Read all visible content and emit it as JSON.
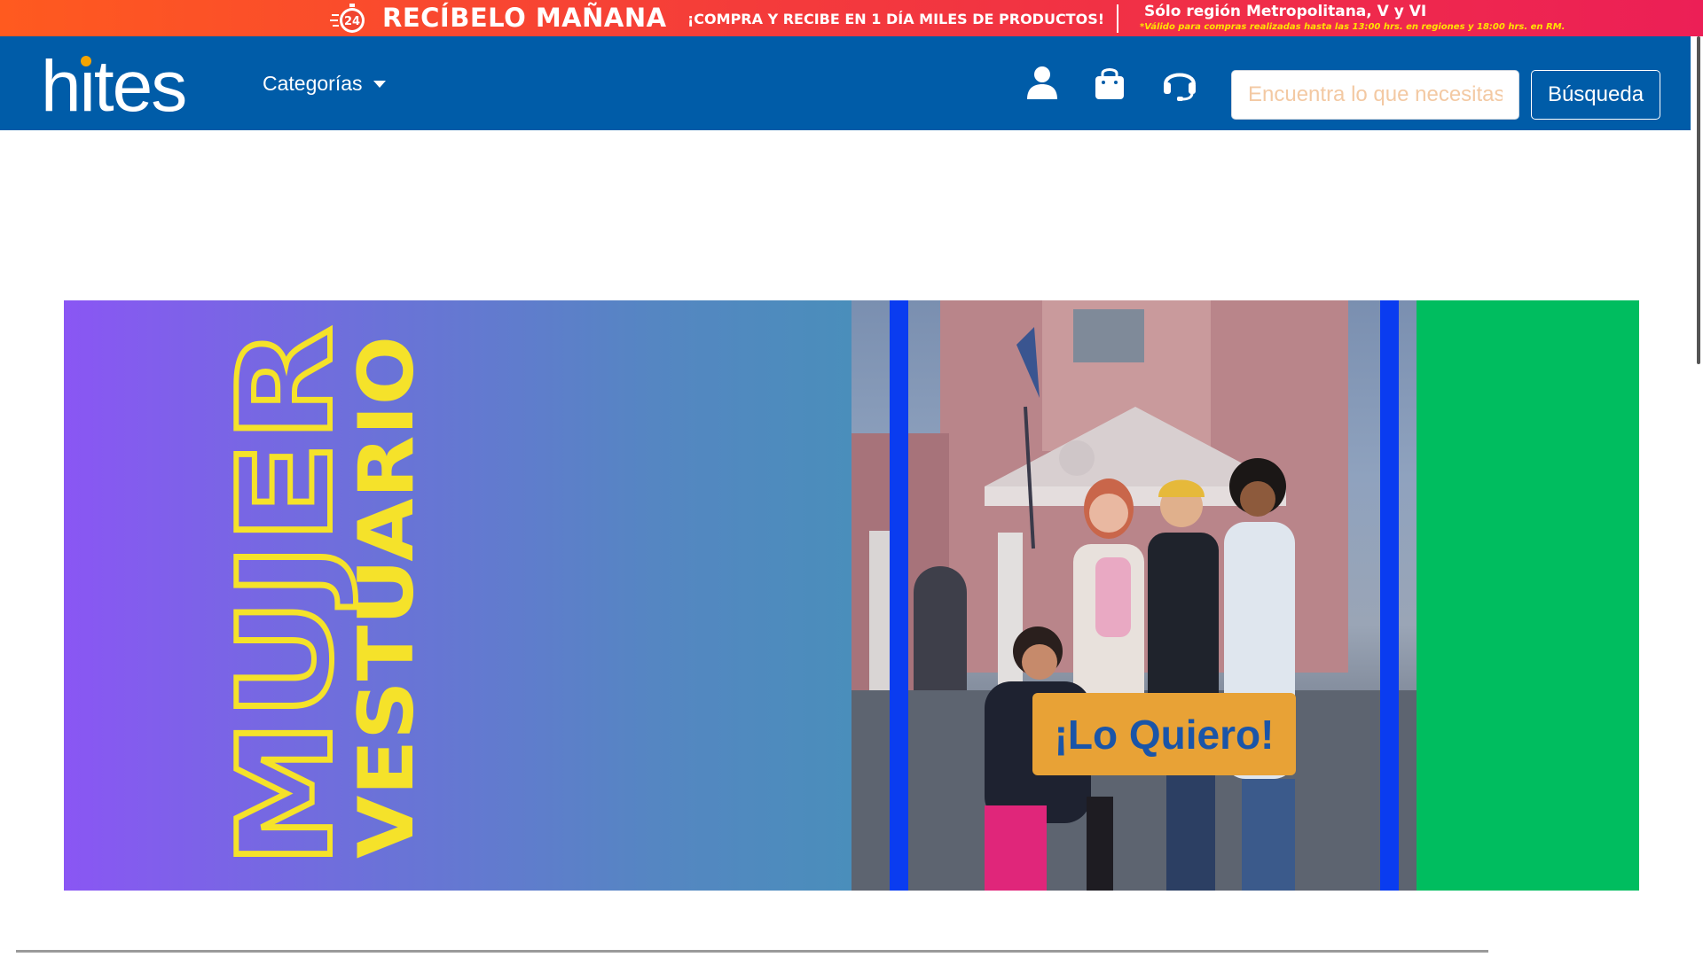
{
  "promo": {
    "title": "RECÍBELO MAÑANA",
    "subtitle": "¡COMPRA Y RECIBE EN 1 DÍA MILES DE PRODUCTOS!",
    "region": "Sólo región Metropolitana, V y VI",
    "note": "*Válido para compras realizadas hasta las 13:00 hrs. en regiones y 18:00 hrs. en RM.",
    "clock_number": "24",
    "clock_icon": "stopwatch-icon"
  },
  "header": {
    "logo": "hites",
    "categories_label": "Categorías",
    "icons": [
      "user-icon",
      "shopping-bag-icon",
      "headset-icon"
    ],
    "search": {
      "placeholder": "Encuentra lo que necesitas",
      "button_label": "Búsqueda"
    }
  },
  "banner": {
    "heading_main": "MUJER",
    "heading_sub": "VESTUARIO",
    "cta_label": "¡Lo Quiero!",
    "colors": {
      "left_gradient_start": "#8a56f4",
      "left_gradient_end": "#4a8ebb",
      "heading": "#f5e22a",
      "right_panel": "#00bd5f",
      "stripe": "#0a3cf0",
      "cta_bg": "#e8a236",
      "cta_text": "#1a55a8"
    }
  },
  "colors": {
    "header_bg": "#005ca8",
    "promo_start": "#ff5a1f",
    "promo_end": "#ec1f56",
    "logo_dot": "#f5a400"
  }
}
